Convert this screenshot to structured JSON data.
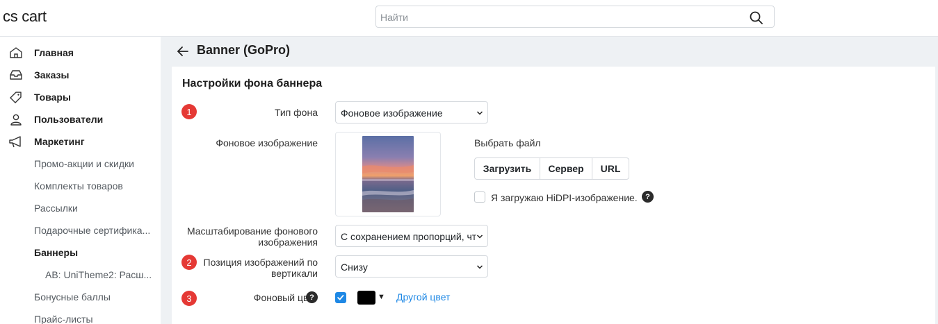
{
  "header": {
    "logo": "cs cart",
    "search_placeholder": "Найти"
  },
  "sidebar": {
    "items": [
      {
        "label": "Главная",
        "icon": "home-icon"
      },
      {
        "label": "Заказы",
        "icon": "inbox-icon"
      },
      {
        "label": "Товары",
        "icon": "tag-icon"
      },
      {
        "label": "Пользователи",
        "icon": "user-icon"
      },
      {
        "label": "Маркетинг",
        "icon": "megaphone-icon"
      }
    ],
    "subitems": [
      {
        "label": "Промо-акции и скидки"
      },
      {
        "label": "Комплекты товаров"
      },
      {
        "label": "Рассылки"
      },
      {
        "label": "Подарочные сертифика..."
      },
      {
        "label": "Баннеры",
        "active": true
      },
      {
        "label": "AB: UniTheme2: Расш..."
      },
      {
        "label": "Бонусные баллы"
      },
      {
        "label": "Прайс-листы"
      }
    ]
  },
  "page": {
    "title": "Banner (GoPro)",
    "section_title": "Настройки фона баннера"
  },
  "form": {
    "bg_type": {
      "badge": "1",
      "label": "Тип фона",
      "value": "Фоновое изображение"
    },
    "bg_image": {
      "label": "Фоновое изображение"
    },
    "upload": {
      "choose_label": "Выбрать файл",
      "buttons": [
        "Загрузить",
        "Сервер",
        "URL"
      ],
      "hidpi_label": "Я загружаю HiDPI-изображение.",
      "hidpi_checked": false
    },
    "scaling": {
      "label_line1": "Масштабирование фонового",
      "label_line2": "изображения",
      "value": "С сохранением пропорций, чт"
    },
    "vpos": {
      "badge": "2",
      "label_line1": "Позиция изображений по",
      "label_line2": "вертикали",
      "value": "Снизу"
    },
    "bg_color": {
      "badge": "3",
      "label": "Фоновый цвет",
      "checked": true,
      "swatch": "#000000",
      "other_color_label": "Другой цвет"
    }
  },
  "colors": {
    "accent": "#1e88e5",
    "badge": "#e53935",
    "main_bg": "#eef1f4"
  }
}
